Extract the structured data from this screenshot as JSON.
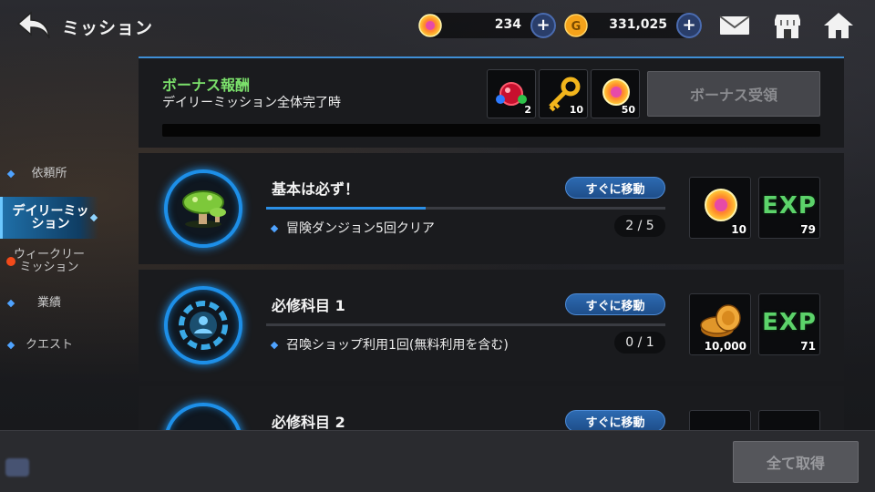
{
  "header": {
    "title": "ミッション",
    "gems": "234",
    "gold": "331,025",
    "plus": "+"
  },
  "sidebar": {
    "items": [
      {
        "label": "依頼所"
      },
      {
        "label": "デイリーミッ\nション"
      },
      {
        "label": "ウィークリー\nミッション"
      },
      {
        "label": "業績"
      },
      {
        "label": "クエスト"
      }
    ]
  },
  "bonus": {
    "title": "ボーナス報酬",
    "subtitle": "デイリーミッション全体完了時",
    "rewards": [
      {
        "icon": "red-gem-bundle-icon",
        "qty": "2"
      },
      {
        "icon": "golden-key-icon",
        "qty": "10"
      },
      {
        "icon": "rainbow-gem-icon",
        "qty": "50"
      }
    ],
    "button": "ボーナス受領",
    "progress": 0
  },
  "missions": [
    {
      "name": "基本は必ず！",
      "goto": "すぐに移動",
      "task": "冒険ダンジョン5回クリア",
      "count": "2 / 5",
      "progress": 0.4,
      "icon": "mushroom-icon",
      "rewards": [
        {
          "icon": "rainbow-gem-icon",
          "qty": "10"
        },
        {
          "icon": "exp-icon",
          "label": "EXP",
          "qty": "79"
        }
      ]
    },
    {
      "name": "必修科目 1",
      "goto": "すぐに移動",
      "task": "召喚ショップ利用1回(無料利用を含む)",
      "count": "0 / 1",
      "progress": 0,
      "icon": "summon-portal-icon",
      "rewards": [
        {
          "icon": "gold-coins-icon",
          "qty": "10,000"
        },
        {
          "icon": "exp-icon",
          "label": "EXP",
          "qty": "71"
        }
      ]
    },
    {
      "name": "必修科目 2",
      "goto": "すぐに移動",
      "task": "",
      "count": "",
      "progress": 0,
      "icon": "mission-icon",
      "rewards": []
    }
  ],
  "footer": {
    "claim_all": "全て取得"
  },
  "colors": {
    "accent_blue": "#1d8fe8",
    "bonus_green": "#7be06b",
    "exp_green": "#5cd36a",
    "badge_red": "#f24a1a"
  }
}
